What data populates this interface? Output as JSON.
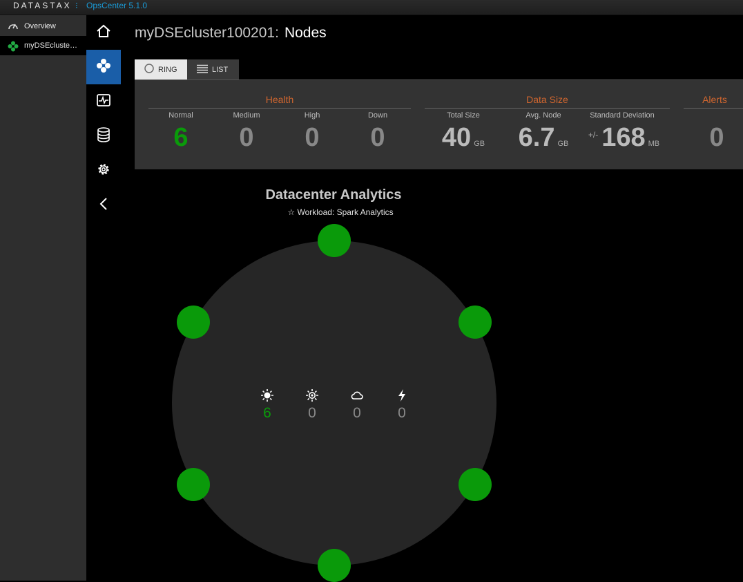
{
  "topbar": {
    "logo": "DATASTAX",
    "product": "OpsCenter 5.1.0"
  },
  "clusters": [
    {
      "label": "Overview",
      "icon": "gauge-icon"
    },
    {
      "label": "myDSEcluste…",
      "icon": "cluster-icon"
    }
  ],
  "rail": [
    "home-icon",
    "nodes-icon",
    "dashboard-icon",
    "database-icon",
    "gear-icon",
    "chevron-left-icon"
  ],
  "page": {
    "cluster": "myDSEcluster100201:",
    "section": "Nodes"
  },
  "tabs": {
    "ring": "RING",
    "list": "LIST"
  },
  "stats": {
    "health": {
      "title": "Health",
      "items": [
        {
          "label": "Normal",
          "value": "6"
        },
        {
          "label": "Medium",
          "value": "0"
        },
        {
          "label": "High",
          "value": "0"
        },
        {
          "label": "Down",
          "value": "0"
        }
      ]
    },
    "data_size": {
      "title": "Data Size",
      "total": {
        "label": "Total Size",
        "value": "40",
        "unit": "GB"
      },
      "avg": {
        "label": "Avg. Node",
        "value": "6.7",
        "unit": "GB"
      },
      "stddev": {
        "label": "Standard Deviation",
        "prefix": "+/-",
        "value": "168",
        "unit": "MB"
      }
    },
    "alerts": {
      "title": "Alerts",
      "value": "0"
    }
  },
  "datacenter": {
    "name": "Datacenter Analytics",
    "workload": "Workload: Spark Analytics",
    "nodes": 6,
    "node_color": "#0a9a0a",
    "workload_counts": [
      {
        "icon": "sun-icon",
        "value": "6"
      },
      {
        "icon": "sun-outline-icon",
        "value": "0"
      },
      {
        "icon": "cloud-icon",
        "value": "0"
      },
      {
        "icon": "lightning-icon",
        "value": "0"
      }
    ]
  },
  "colors": {
    "accent": "#1a5ea8",
    "health_title": "#d0662f",
    "normal_green": "#0a9a0a"
  }
}
